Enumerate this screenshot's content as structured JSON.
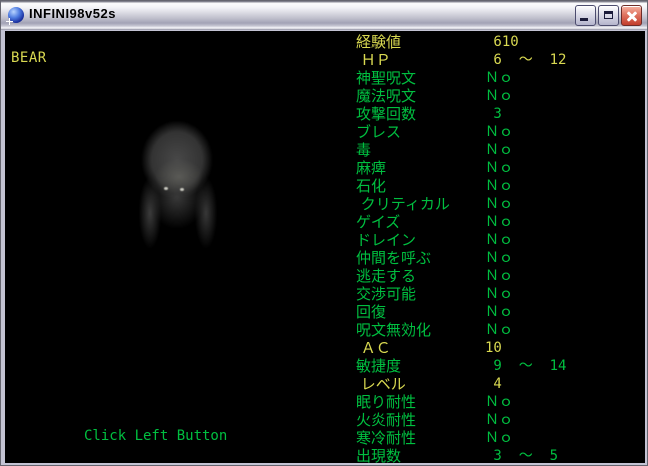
{
  "window": {
    "title": "INFINI98v52s"
  },
  "colors": {
    "yellow": "#d9d951",
    "green": "#00bf40",
    "client_background": "#000000"
  },
  "left_panel": {
    "monster_name": "BEAR",
    "portrait": "bear-image",
    "prompt": "Click Left Button"
  },
  "stats": [
    {
      "label": "経験値",
      "value": " 610",
      "color": "yellow"
    },
    {
      "label": " ＨＰ",
      "value": " 6  ～  12",
      "color": "yellow"
    },
    {
      "label": "神聖呪文",
      "value": "Ｎｏ",
      "color": "green"
    },
    {
      "label": "魔法呪文",
      "value": "Ｎｏ",
      "color": "green"
    },
    {
      "label": "攻撃回数",
      "value": " 3",
      "color": "green"
    },
    {
      "label": "ブレス",
      "value": "Ｎｏ",
      "color": "green"
    },
    {
      "label": "毒",
      "value": "Ｎｏ",
      "color": "green"
    },
    {
      "label": "麻痺",
      "value": "Ｎｏ",
      "color": "green"
    },
    {
      "label": "石化",
      "value": "Ｎｏ",
      "color": "green"
    },
    {
      "label": " クリティカル",
      "value": "Ｎｏ",
      "color": "green"
    },
    {
      "label": "ゲイズ",
      "value": "Ｎｏ",
      "color": "green"
    },
    {
      "label": "ドレイン",
      "value": "Ｎｏ",
      "color": "green"
    },
    {
      "label": "仲間を呼ぶ",
      "value": "Ｎｏ",
      "color": "green"
    },
    {
      "label": "逃走する",
      "value": "Ｎｏ",
      "color": "green"
    },
    {
      "label": "交渉可能",
      "value": "Ｎｏ",
      "color": "green"
    },
    {
      "label": "回復",
      "value": "Ｎｏ",
      "color": "green"
    },
    {
      "label": "呪文無効化",
      "value": "Ｎｏ",
      "color": "green"
    },
    {
      "label": " ＡＣ",
      "value": "10",
      "color": "yellow"
    },
    {
      "label": "敏捷度",
      "value": " 9  ～  14",
      "color": "green"
    },
    {
      "label": " レベル",
      "value": " 4",
      "color": "yellow"
    },
    {
      "label": "眠り耐性",
      "value": "Ｎｏ",
      "color": "green"
    },
    {
      "label": "火炎耐性",
      "value": "Ｎｏ",
      "color": "green"
    },
    {
      "label": "寒冷耐性",
      "value": "Ｎｏ",
      "color": "green"
    },
    {
      "label": "出現数",
      "value": " 3  ～  5",
      "color": "green"
    }
  ]
}
